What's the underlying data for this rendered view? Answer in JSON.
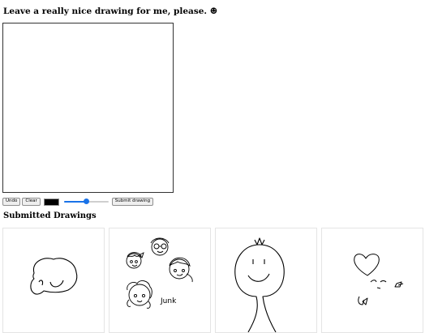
{
  "header": {
    "title": "Leave a really nice drawing for me, please. ☻"
  },
  "toolbar": {
    "undo_label": "Undo",
    "clear_label": "Clear",
    "color": "#000000",
    "brush_size_fraction": 0.5,
    "submit_label": "Submit drawing"
  },
  "gallery": {
    "title": "Submitted Drawings",
    "items": [
      {
        "id": "blob-face"
      },
      {
        "id": "multiple-faces",
        "caption": "Junk"
      },
      {
        "id": "balloon-face"
      },
      {
        "id": "heart-doodle"
      }
    ]
  },
  "colors": {
    "accent": "#1a73e8",
    "border": "#e4e4e4"
  }
}
